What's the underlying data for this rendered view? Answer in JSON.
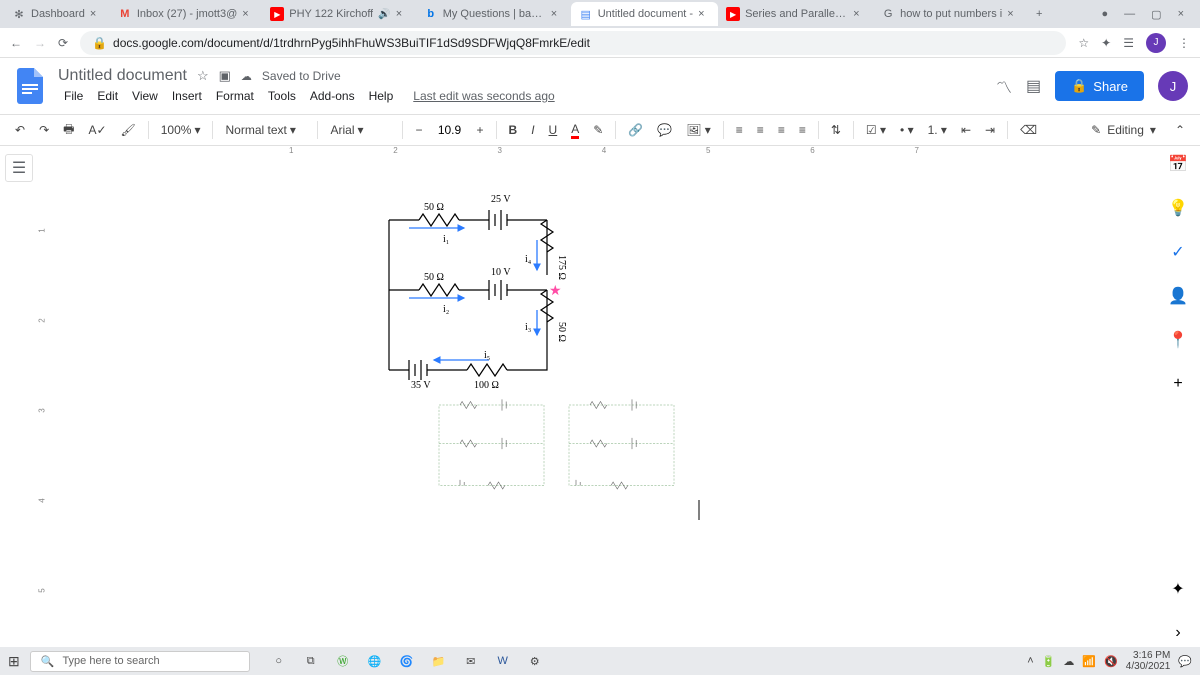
{
  "browser": {
    "tabs": [
      {
        "title": "Dashboard",
        "icon": "✻"
      },
      {
        "title": "Inbox (27) - jmott3@",
        "icon": "M"
      },
      {
        "title": "PHY 122 Kirchoff",
        "icon": "▶"
      },
      {
        "title": "My Questions | bartle",
        "icon": "b"
      },
      {
        "title": "Untitled document - ",
        "icon": "≡",
        "active": true
      },
      {
        "title": "Series and Parallel Cir",
        "icon": "▶"
      },
      {
        "title": "how to put numbers i",
        "icon": "G"
      }
    ],
    "url": "docs.google.com/document/d/1trdhrnPyg5ihhFhuWS3BuiTIF1dSd9SDFWjqQ8FmrkE/edit"
  },
  "doc": {
    "title": "Untitled document",
    "saved": "Saved to Drive",
    "menus": [
      "File",
      "Edit",
      "View",
      "Insert",
      "Format",
      "Tools",
      "Add-ons",
      "Help"
    ],
    "lastedit": "Last edit was seconds ago",
    "share": "Share",
    "avatar": "J"
  },
  "toolbar": {
    "zoom": "100%",
    "style": "Normal text",
    "font": "Arial",
    "size": "10.9",
    "mode": "Editing"
  },
  "ruler": {
    "h": [
      "1",
      "2",
      "3",
      "4",
      "5",
      "6",
      "7"
    ],
    "v": [
      "1",
      "2",
      "3",
      "4",
      "5"
    ]
  },
  "circuit": {
    "r1": "50 Ω",
    "r2": "50 Ω",
    "r3": "175 Ω",
    "r4": "50 Ω",
    "r5": "100 Ω",
    "v1": "25 V",
    "v2": "10 V",
    "v3": "35 V",
    "i1": "i₁",
    "i2": "i₂",
    "i3": "i₃",
    "i4": "i₄",
    "i5": "i₅"
  },
  "taskbar": {
    "search": "Type here to search",
    "time": "3:16 PM",
    "date": "4/30/2021"
  }
}
